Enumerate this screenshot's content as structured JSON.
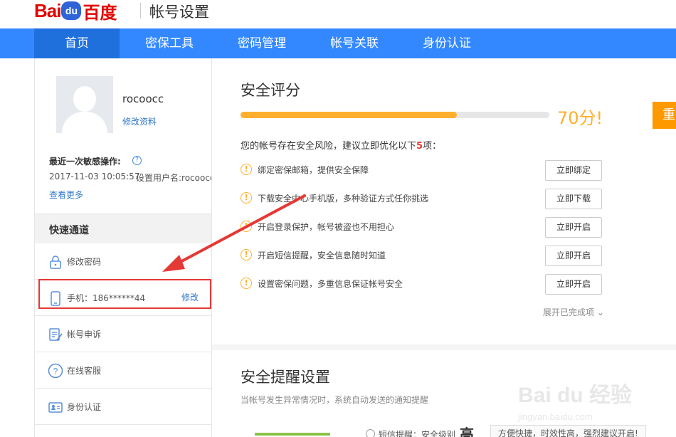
{
  "header": {
    "logo_bai": "Bai",
    "logo_du": "du",
    "logo_cn": "百度",
    "page_title": "帐号设置"
  },
  "nav": {
    "items": [
      "首页",
      "密保工具",
      "密码管理",
      "帐号关联",
      "身份认证"
    ],
    "active_index": 0
  },
  "sidebar": {
    "username": "rocoocc",
    "edit_profile": "修改资料",
    "recent_label": "最近一次敏感操作:",
    "recent_time": "2017-11-03 10:05:57",
    "recent_action": "设置用户名:rocoocc",
    "view_more": "查看更多",
    "quick_title": "快速通道",
    "quick_items": [
      {
        "icon": "lock-icon",
        "label": "修改密码",
        "action": ""
      },
      {
        "icon": "phone-icon",
        "label": "手机：186******44",
        "action": "修改"
      },
      {
        "icon": "appeal-icon",
        "label": "帐号申诉",
        "action": ""
      },
      {
        "icon": "help-circle-icon",
        "label": "在线客服",
        "action": ""
      },
      {
        "icon": "id-card-icon",
        "label": "身份认证",
        "action": ""
      }
    ]
  },
  "security": {
    "title": "安全评分",
    "score_text": "70分!",
    "score_fraction": 0.7,
    "score_color": "#ffaf2e",
    "orange_button": "重",
    "risk_text_pre": "您的帐号存在安全风险，建议立即优化以下",
    "risk_count": "5",
    "risk_text_post": "项：",
    "risks": [
      {
        "label": "绑定密保邮箱，提供安全保障",
        "button": "立即绑定"
      },
      {
        "label": "下载安全中心手机版，多种验证方式任你挑选",
        "button": "立即下载"
      },
      {
        "label": "开启登录保护，帐号被盗也不用担心",
        "button": "立即开启"
      },
      {
        "label": "开启短信提醒，安全信息随时知道",
        "button": "立即开启"
      },
      {
        "label": "设置密保问题，多重信息保证帐号安全",
        "button": "立即开启"
      }
    ],
    "expand_done": "展开已完成项"
  },
  "notice": {
    "title": "安全提醒设置",
    "desc": "当帐号发生异常情况时，系统自动发送的通知提醒",
    "sms_label": "短信提醒：安全级别",
    "level": "高",
    "tip": "方便快捷，时效性高，强烈建议开启!"
  },
  "watermark": {
    "big": "Bai du 经验",
    "small": "jingyan.baidu.com"
  },
  "colors": {
    "nav": "#3388ff",
    "nav_active": "#1f6fdc",
    "link": "#3078c8",
    "annotation": "#e53935"
  }
}
